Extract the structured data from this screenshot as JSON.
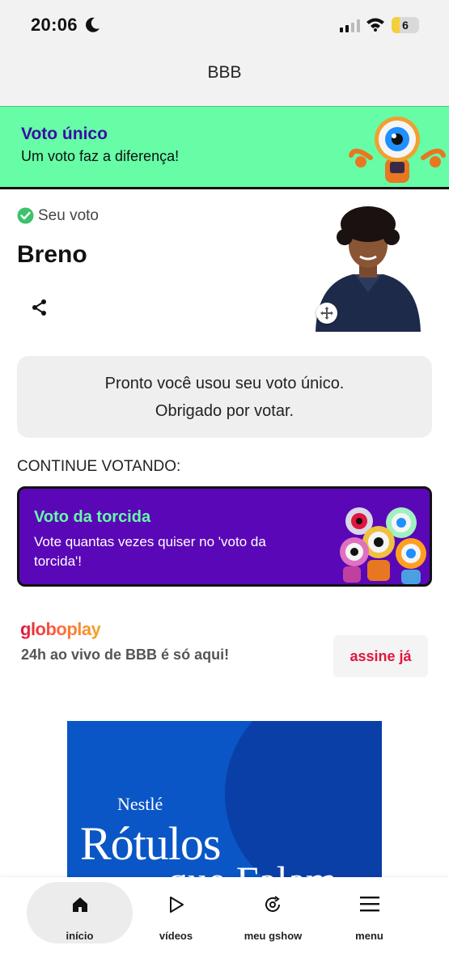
{
  "status_bar": {
    "time": "20:06",
    "battery": "6",
    "battery_level": 0.3
  },
  "nav": {
    "title": "BBB"
  },
  "banner": {
    "title": "Voto único",
    "subtitle": "Um voto faz a diferença!"
  },
  "vote": {
    "label": "Seu voto",
    "candidate": "Breno",
    "message_line1": "Pronto você usou seu voto único.",
    "message_line2": "Obrigado por votar."
  },
  "continue_label": "CONTINUE VOTANDO:",
  "torcida": {
    "title": "Voto da torcida",
    "subtitle": "Vote quantas vezes quiser no 'voto da torcida'!"
  },
  "globoplay": {
    "logo": "globoplay",
    "text": "24h ao vivo de BBB é só aqui!",
    "button": "assine já"
  },
  "ad": {
    "brand": "Nestlé",
    "line1": "Rótulos",
    "line2": "que Falam"
  },
  "tabs": [
    {
      "label": "início",
      "icon": "home-icon"
    },
    {
      "label": "vídeos",
      "icon": "play-icon"
    },
    {
      "label": "meu gshow",
      "icon": "refresh-icon"
    },
    {
      "label": "menu",
      "icon": "menu-icon"
    }
  ],
  "colors": {
    "banner_bg": "#66fda6",
    "banner_title": "#3a0ca3",
    "torcida_bg": "#5a07b8",
    "torcida_title": "#66fda6",
    "accent_red": "#e0163e"
  }
}
